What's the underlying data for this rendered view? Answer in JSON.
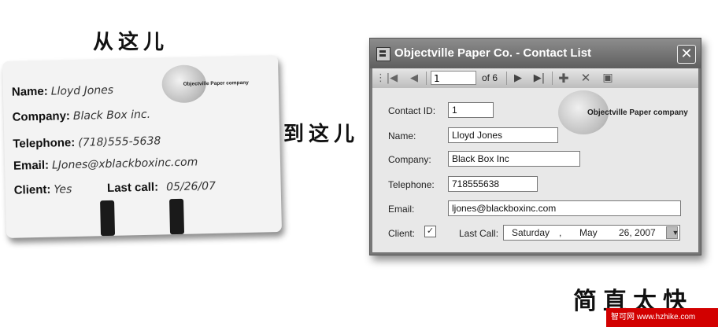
{
  "captions": {
    "from_here": "从这儿",
    "to_here": "到这儿",
    "so_simple": "简直太快"
  },
  "card": {
    "name_label": "Name:",
    "name_value": "Lloyd Jones",
    "company_label": "Company:",
    "company_value": "Black Box inc.",
    "telephone_label": "Telephone:",
    "telephone_value": "(718)555-5638",
    "email_label": "Email:",
    "email_value": "LJones@xblackboxinc.com",
    "client_label": "Client:",
    "client_value": "Yes",
    "last_call_label": "Last call:",
    "last_call_value": "05/26/07",
    "logo_text": "Objectville Paper company"
  },
  "window": {
    "title": "Objectville Paper Co. - Contact List",
    "toolbar": {
      "position": "1",
      "of_label": "of 6"
    },
    "logo_text": "Objectville Paper company",
    "fields": {
      "contact_id_label": "Contact ID:",
      "contact_id_value": "1",
      "name_label": "Name:",
      "name_value": "Lloyd Jones",
      "company_label": "Company:",
      "company_value": "Black Box Inc",
      "telephone_label": "Telephone:",
      "telephone_value": "718555638",
      "email_label": "Email:",
      "email_value": "ljones@blackboxinc.com",
      "client_label": "Client:",
      "client_checked": "✓",
      "last_call_label": "Last Call:",
      "last_call_day": "Saturday",
      "last_call_month": "May",
      "last_call_date": "26, 2007"
    }
  },
  "watermark": "智可网  www.hzhike.com"
}
